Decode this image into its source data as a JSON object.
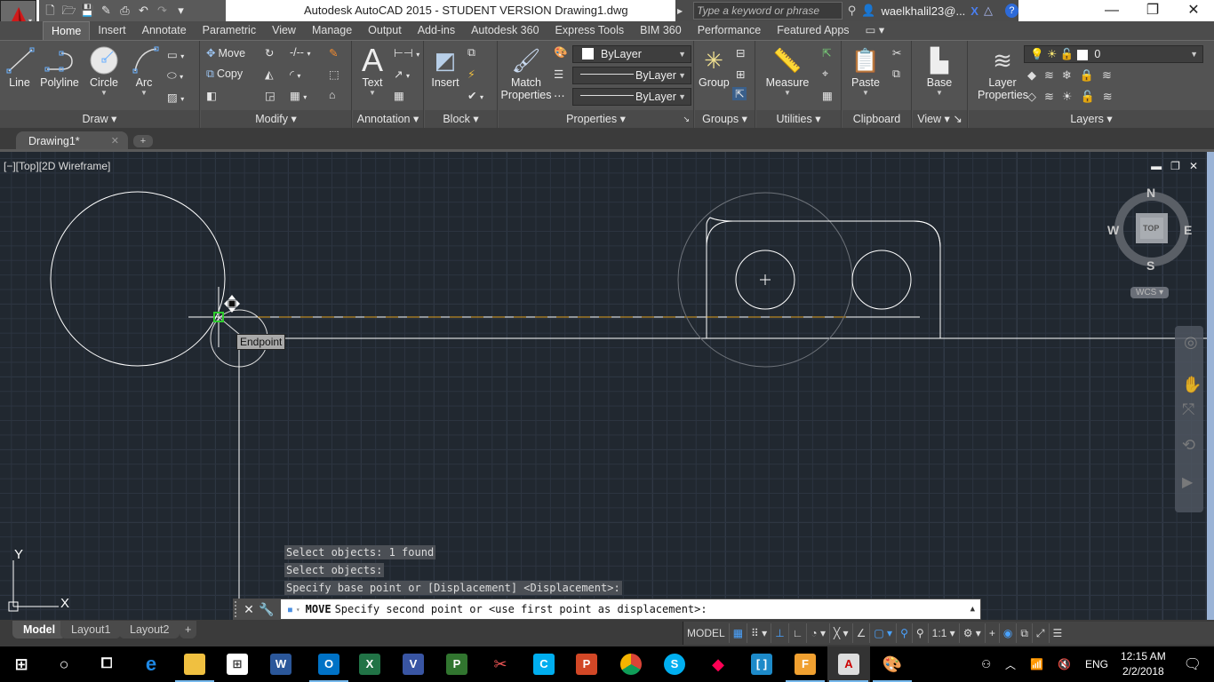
{
  "window": {
    "title": "Autodesk AutoCAD 2015 - STUDENT VERSION    Drawing1.dwg",
    "search_placeholder": "Type a keyword or phrase",
    "user": "waelkhalil23@...",
    "controls": {
      "minimize": "—",
      "restore": "❐",
      "close": "✕"
    }
  },
  "quick_access": [
    "new-icon",
    "open-icon",
    "save-icon",
    "save-as-icon",
    "plot-icon",
    "undo-icon",
    "redo-icon",
    "customize-icon"
  ],
  "ribbon_tabs": [
    "Home",
    "Insert",
    "Annotate",
    "Parametric",
    "View",
    "Manage",
    "Output",
    "Add-ins",
    "Autodesk 360",
    "Express Tools",
    "BIM 360",
    "Performance",
    "Featured Apps"
  ],
  "active_tab": "Home",
  "panels": {
    "draw": {
      "title": "Draw",
      "buttons": [
        "Line",
        "Polyline",
        "Circle",
        "Arc"
      ]
    },
    "modify": {
      "title": "Modify",
      "move": "Move",
      "copy": "Copy"
    },
    "annotation": {
      "title": "Annotation",
      "text": "Text"
    },
    "block": {
      "title": "Block",
      "insert": "Insert"
    },
    "properties": {
      "title": "Properties",
      "match": "Match",
      "match2": "Properties",
      "color": "ByLayer",
      "linetype": "ByLayer",
      "lineweight": "ByLayer"
    },
    "groups": {
      "title": "Groups",
      "group": "Group"
    },
    "utilities": {
      "title": "Utilities",
      "measure": "Measure"
    },
    "clipboard": {
      "title": "Clipboard",
      "paste": "Paste"
    },
    "view": {
      "title": "View",
      "base": "Base"
    },
    "layers": {
      "title": "Layers",
      "layer_props1": "Layer",
      "layer_props2": "Properties",
      "current_layer": "0"
    }
  },
  "document_tab": {
    "name": "Drawing1*",
    "close": "✕",
    "new": "+"
  },
  "viewport": {
    "label": "[−][Top][2D Wireframe]",
    "controls": {
      "minimize": "▬",
      "restore": "❐",
      "close": "✕"
    },
    "osnap_tooltip": "Endpoint",
    "viewcube": {
      "n": "N",
      "s": "S",
      "e": "E",
      "w": "W",
      "face": "TOP",
      "wcs": "WCS"
    },
    "ucs": {
      "x": "X",
      "y": "Y"
    }
  },
  "command": {
    "history": [
      "Select objects: 1 found",
      "Select objects:",
      "Specify base point or [Displacement] <Displacement>:"
    ],
    "current_command": "MOVE",
    "prompt": "Specify second point or <use first point as displacement>:"
  },
  "layout_tabs": [
    "Model",
    "Layout1",
    "Layout2"
  ],
  "active_layout": "Model",
  "status": {
    "model": "MODEL",
    "scale": "1:1"
  },
  "taskbar": {
    "apps": [
      "start",
      "search",
      "task-view",
      "edge",
      "file-explorer",
      "store",
      "word",
      "outlook",
      "excel",
      "visio",
      "project",
      "snipping-tool",
      "app-c",
      "powerpoint",
      "chrome",
      "skype",
      "app-git",
      "app-brackets",
      "fusion",
      "autocad",
      "paint"
    ],
    "language": "ENG",
    "time": "12:15 AM",
    "date": "2/2/2018"
  },
  "colors": {
    "accent": "#4aa3ff",
    "canvas": "#212830",
    "osnap": "#2ecc2e",
    "tracking": "#e0a020"
  }
}
